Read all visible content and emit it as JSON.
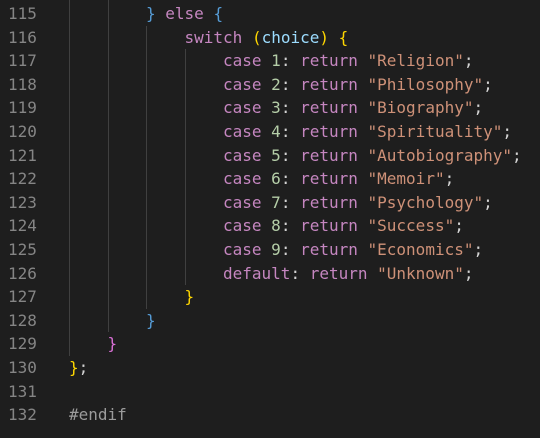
{
  "editor": {
    "lines": [
      {
        "num": "115",
        "indent": 2,
        "tokens": [
          {
            "t": "}",
            "c": "t-bracket1"
          },
          {
            "t": " ",
            "c": "t-plain"
          },
          {
            "t": "else",
            "c": "t-keyword-ctrl"
          },
          {
            "t": " ",
            "c": "t-plain"
          },
          {
            "t": "{",
            "c": "t-bracket1"
          }
        ]
      },
      {
        "num": "116",
        "indent": 3,
        "tokens": [
          {
            "t": "switch",
            "c": "t-keyword-ctrl"
          },
          {
            "t": " ",
            "c": "t-plain"
          },
          {
            "t": "(",
            "c": "t-bracket2"
          },
          {
            "t": "choice",
            "c": "t-choice"
          },
          {
            "t": ")",
            "c": "t-bracket2"
          },
          {
            "t": " ",
            "c": "t-plain"
          },
          {
            "t": "{",
            "c": "t-bracket2"
          }
        ]
      },
      {
        "num": "117",
        "indent": 4,
        "tokens": [
          {
            "t": "case",
            "c": "t-keyword-ctrl"
          },
          {
            "t": " ",
            "c": "t-plain"
          },
          {
            "t": "1",
            "c": "t-num"
          },
          {
            "t": ": ",
            "c": "t-punct"
          },
          {
            "t": "return",
            "c": "t-keyword-ctrl"
          },
          {
            "t": " ",
            "c": "t-plain"
          },
          {
            "t": "\"Religion\"",
            "c": "t-str"
          },
          {
            "t": ";",
            "c": "t-punct"
          }
        ]
      },
      {
        "num": "118",
        "indent": 4,
        "tokens": [
          {
            "t": "case",
            "c": "t-keyword-ctrl"
          },
          {
            "t": " ",
            "c": "t-plain"
          },
          {
            "t": "2",
            "c": "t-num"
          },
          {
            "t": ": ",
            "c": "t-punct"
          },
          {
            "t": "return",
            "c": "t-keyword-ctrl"
          },
          {
            "t": " ",
            "c": "t-plain"
          },
          {
            "t": "\"Philosophy\"",
            "c": "t-str"
          },
          {
            "t": ";",
            "c": "t-punct"
          }
        ]
      },
      {
        "num": "119",
        "indent": 4,
        "tokens": [
          {
            "t": "case",
            "c": "t-keyword-ctrl"
          },
          {
            "t": " ",
            "c": "t-plain"
          },
          {
            "t": "3",
            "c": "t-num"
          },
          {
            "t": ": ",
            "c": "t-punct"
          },
          {
            "t": "return",
            "c": "t-keyword-ctrl"
          },
          {
            "t": " ",
            "c": "t-plain"
          },
          {
            "t": "\"Biography\"",
            "c": "t-str"
          },
          {
            "t": ";",
            "c": "t-punct"
          }
        ]
      },
      {
        "num": "120",
        "indent": 4,
        "tokens": [
          {
            "t": "case",
            "c": "t-keyword-ctrl"
          },
          {
            "t": " ",
            "c": "t-plain"
          },
          {
            "t": "4",
            "c": "t-num"
          },
          {
            "t": ": ",
            "c": "t-punct"
          },
          {
            "t": "return",
            "c": "t-keyword-ctrl"
          },
          {
            "t": " ",
            "c": "t-plain"
          },
          {
            "t": "\"Spirituality\"",
            "c": "t-str"
          },
          {
            "t": ";",
            "c": "t-punct"
          }
        ]
      },
      {
        "num": "121",
        "indent": 4,
        "tokens": [
          {
            "t": "case",
            "c": "t-keyword-ctrl"
          },
          {
            "t": " ",
            "c": "t-plain"
          },
          {
            "t": "5",
            "c": "t-num"
          },
          {
            "t": ": ",
            "c": "t-punct"
          },
          {
            "t": "return",
            "c": "t-keyword-ctrl"
          },
          {
            "t": " ",
            "c": "t-plain"
          },
          {
            "t": "\"Autobiography\"",
            "c": "t-str"
          },
          {
            "t": ";",
            "c": "t-punct"
          }
        ]
      },
      {
        "num": "122",
        "indent": 4,
        "tokens": [
          {
            "t": "case",
            "c": "t-keyword-ctrl"
          },
          {
            "t": " ",
            "c": "t-plain"
          },
          {
            "t": "6",
            "c": "t-num"
          },
          {
            "t": ": ",
            "c": "t-punct"
          },
          {
            "t": "return",
            "c": "t-keyword-ctrl"
          },
          {
            "t": " ",
            "c": "t-plain"
          },
          {
            "t": "\"Memoir\"",
            "c": "t-str"
          },
          {
            "t": ";",
            "c": "t-punct"
          }
        ]
      },
      {
        "num": "123",
        "indent": 4,
        "tokens": [
          {
            "t": "case",
            "c": "t-keyword-ctrl"
          },
          {
            "t": " ",
            "c": "t-plain"
          },
          {
            "t": "7",
            "c": "t-num"
          },
          {
            "t": ": ",
            "c": "t-punct"
          },
          {
            "t": "return",
            "c": "t-keyword-ctrl"
          },
          {
            "t": " ",
            "c": "t-plain"
          },
          {
            "t": "\"Psychology\"",
            "c": "t-str"
          },
          {
            "t": ";",
            "c": "t-punct"
          }
        ]
      },
      {
        "num": "124",
        "indent": 4,
        "tokens": [
          {
            "t": "case",
            "c": "t-keyword-ctrl"
          },
          {
            "t": " ",
            "c": "t-plain"
          },
          {
            "t": "8",
            "c": "t-num"
          },
          {
            "t": ": ",
            "c": "t-punct"
          },
          {
            "t": "return",
            "c": "t-keyword-ctrl"
          },
          {
            "t": " ",
            "c": "t-plain"
          },
          {
            "t": "\"Success\"",
            "c": "t-str"
          },
          {
            "t": ";",
            "c": "t-punct"
          }
        ]
      },
      {
        "num": "125",
        "indent": 4,
        "tokens": [
          {
            "t": "case",
            "c": "t-keyword-ctrl"
          },
          {
            "t": " ",
            "c": "t-plain"
          },
          {
            "t": "9",
            "c": "t-num"
          },
          {
            "t": ": ",
            "c": "t-punct"
          },
          {
            "t": "return",
            "c": "t-keyword-ctrl"
          },
          {
            "t": " ",
            "c": "t-plain"
          },
          {
            "t": "\"Economics\"",
            "c": "t-str"
          },
          {
            "t": ";",
            "c": "t-punct"
          }
        ]
      },
      {
        "num": "126",
        "indent": 4,
        "tokens": [
          {
            "t": "default",
            "c": "t-keyword-ctrl"
          },
          {
            "t": ": ",
            "c": "t-punct"
          },
          {
            "t": "return",
            "c": "t-keyword-ctrl"
          },
          {
            "t": " ",
            "c": "t-plain"
          },
          {
            "t": "\"Unknown\"",
            "c": "t-str"
          },
          {
            "t": ";",
            "c": "t-punct"
          }
        ]
      },
      {
        "num": "127",
        "indent": 3,
        "tokens": [
          {
            "t": "}",
            "c": "t-bracket2"
          }
        ]
      },
      {
        "num": "128",
        "indent": 2,
        "tokens": [
          {
            "t": "}",
            "c": "t-bracket1"
          }
        ]
      },
      {
        "num": "129",
        "indent": 1,
        "tokens": [
          {
            "t": "}",
            "c": "t-bracket3"
          }
        ]
      },
      {
        "num": "130",
        "indent": 0,
        "tokens": [
          {
            "t": "}",
            "c": "t-bracket2"
          },
          {
            "t": ";",
            "c": "t-punct"
          }
        ]
      },
      {
        "num": "131",
        "indent": 0,
        "tokens": []
      },
      {
        "num": "132",
        "indent": 0,
        "tokens": [
          {
            "t": "#endif",
            "c": "t-pre"
          }
        ]
      }
    ]
  },
  "colors": {
    "background": "#1e1e1e",
    "line_number": "#858585",
    "indent_guide": "#404040"
  }
}
